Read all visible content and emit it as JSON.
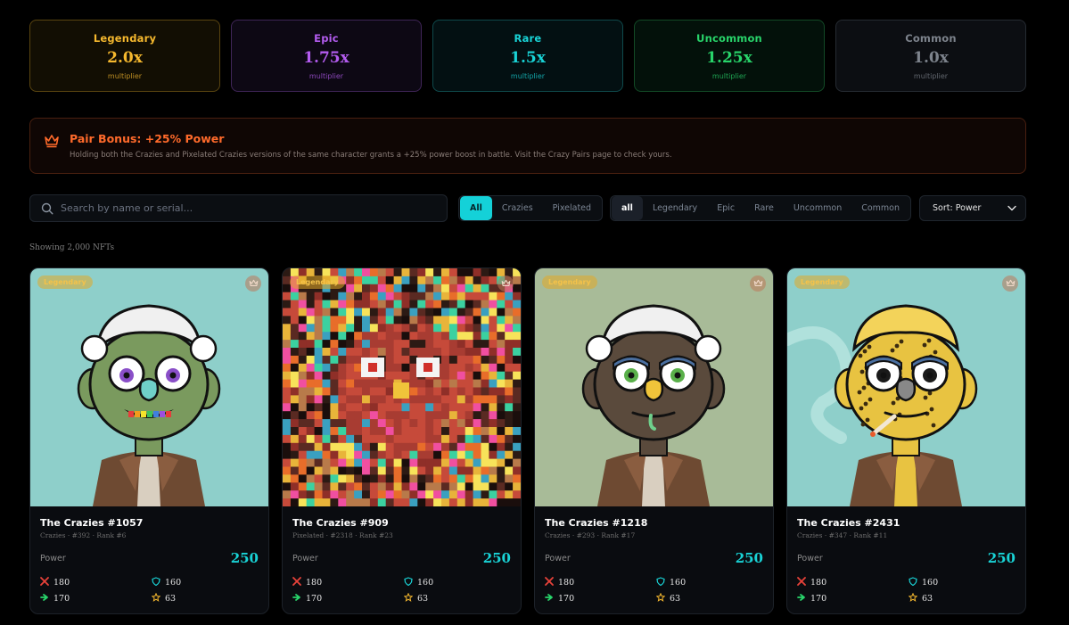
{
  "rarities": [
    {
      "name": "Legendary",
      "multiplier": "2.0x",
      "sub": "multiplier",
      "color": "#f5b82e",
      "border": "#5a4510",
      "bg": "#120e03"
    },
    {
      "name": "Epic",
      "multiplier": "1.75x",
      "sub": "multiplier",
      "color": "#b45cf0",
      "border": "#3f2557",
      "bg": "#0d0814"
    },
    {
      "name": "Rare",
      "multiplier": "1.5x",
      "sub": "multiplier",
      "color": "#19d3d6",
      "border": "#0f4a4c",
      "bg": "#031012"
    },
    {
      "name": "Uncommon",
      "multiplier": "1.25x",
      "sub": "multiplier",
      "color": "#28d46a",
      "border": "#124a26",
      "bg": "#03110a"
    },
    {
      "name": "Common",
      "multiplier": "1.0x",
      "sub": "multiplier",
      "color": "#7d838c",
      "border": "#262b32",
      "bg": "#0c0e12"
    }
  ],
  "pair_bonus": {
    "title": "Pair Bonus: +25% Power",
    "description": "Holding both the Crazies and Pixelated Crazies versions of the same character grants a +25% power boost in battle. Visit the Crazy Pairs page to check yours.",
    "icon": "crown-icon"
  },
  "search": {
    "placeholder": "Search by name or serial...",
    "value": ""
  },
  "type_filter": {
    "options": [
      "All",
      "Crazies",
      "Pixelated"
    ],
    "selected": "All"
  },
  "rarity_filter": {
    "options": [
      "all",
      "Legendary",
      "Epic",
      "Rare",
      "Uncommon",
      "Common"
    ],
    "selected": "all"
  },
  "sort": {
    "label": "Sort: Power",
    "icon": "chevron-down-icon"
  },
  "showing": "Showing 2,000 NFTs",
  "power_label": "Power",
  "nfts": [
    {
      "badge": "Legendary",
      "title": "The Crazies #1057",
      "meta": "Crazies · #392 · Rank #6",
      "power": "250",
      "attack": "180",
      "defense": "160",
      "speed": "170",
      "luck": "63",
      "art": "zombie-green",
      "bg": "#8ecfca"
    },
    {
      "badge": "Legendary",
      "title": "The Crazies #909",
      "meta": "Pixelated · #2318 · Rank #23",
      "power": "250",
      "attack": "180",
      "defense": "160",
      "speed": "170",
      "luck": "63",
      "art": "pixelated",
      "bg": "#3a1a18"
    },
    {
      "badge": "Legendary",
      "title": "The Crazies #1218",
      "meta": "Crazies · #293 · Rank #17",
      "power": "250",
      "attack": "180",
      "defense": "160",
      "speed": "170",
      "luck": "63",
      "art": "zombie-dark",
      "bg": "#a8bb98"
    },
    {
      "badge": "Legendary",
      "title": "The Crazies #2431",
      "meta": "Crazies · #347 · Rank #11",
      "power": "250",
      "attack": "180",
      "defense": "160",
      "speed": "170",
      "luck": "63",
      "art": "leopard-smoker",
      "bg": "#8ecfca"
    }
  ]
}
